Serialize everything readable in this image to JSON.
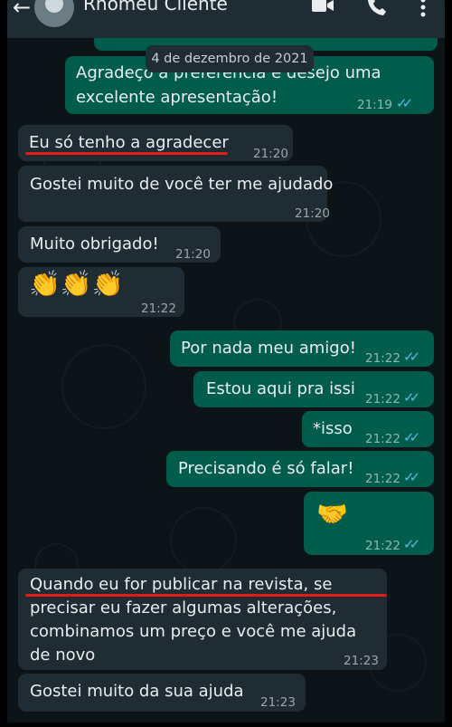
{
  "header": {
    "contact_name": "Rhomeu Cliente",
    "back_icon": "back-arrow-icon",
    "video_icon": "video-call-icon",
    "call_icon": "phone-icon",
    "menu_icon": "kebab-menu-icon"
  },
  "date_divider": "4 de dezembro de 2021",
  "colors": {
    "incoming_bubble": "#1f2c34",
    "outgoing_bubble": "#005c4b",
    "read_ticks": "#53bdeb",
    "highlight_underline": "#e21a1a"
  },
  "messages": [
    {
      "direction": "out",
      "lines": [
        "Agradeço a preferência e desejo uma",
        "excelente apresentação!"
      ],
      "time": "21:19",
      "status": "read"
    },
    {
      "direction": "in",
      "text": "Eu só tenho a agradecer",
      "time": "21:20",
      "underlined": true
    },
    {
      "direction": "in",
      "text": "Gostei muito de você ter me ajudado",
      "time": "21:20"
    },
    {
      "direction": "in",
      "text": "Muito obrigado!",
      "time": "21:20"
    },
    {
      "direction": "in",
      "emoji": "👏👏👏",
      "emoji_name": "clapping-hands",
      "time": "21:22"
    },
    {
      "direction": "out",
      "text": "Por nada meu amigo!",
      "time": "21:22",
      "status": "read"
    },
    {
      "direction": "out",
      "text": "Estou aqui pra issi",
      "time": "21:22",
      "status": "read"
    },
    {
      "direction": "out",
      "text": "*isso",
      "time": "21:22",
      "status": "read"
    },
    {
      "direction": "out",
      "text": "Precisando é só falar!",
      "time": "21:22",
      "status": "read"
    },
    {
      "direction": "out",
      "emoji": "🤝",
      "emoji_name": "handshake",
      "time": "21:22",
      "status": "read"
    },
    {
      "direction": "in",
      "lines": [
        "Quando eu for publicar na revista, se",
        "precisar eu fazer algumas alterações,",
        "combinamos um preço e você me ajuda",
        "de novo"
      ],
      "time": "21:23",
      "underlined": true
    },
    {
      "direction": "in",
      "text": "Gostei muito da sua ajuda",
      "time": "21:23"
    }
  ]
}
